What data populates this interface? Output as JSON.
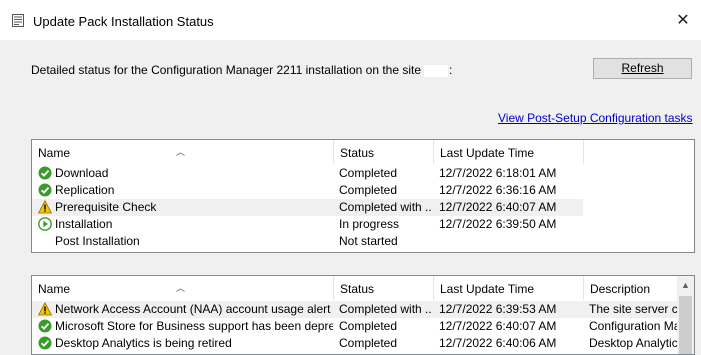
{
  "window": {
    "title": "Update Pack Installation Status",
    "close_glyph": "✕"
  },
  "description": {
    "text_before": "Detailed status for the Configuration Manager 2211 installation on the site",
    "text_after": ":"
  },
  "refresh_button": {
    "label": "Refresh"
  },
  "post_setup_link": "View Post-Setup Configuration tasks",
  "status_list": {
    "columns": [
      "Name",
      "Status",
      "Last Update Time"
    ],
    "rows": [
      {
        "icon": "check-icon",
        "name": "Download",
        "status": "Completed",
        "time": "12/7/2022 6:18:01 AM"
      },
      {
        "icon": "check-icon",
        "name": "Replication",
        "status": "Completed",
        "time": "12/7/2022 6:36:16 AM"
      },
      {
        "icon": "warning-icon",
        "name": "Prerequisite Check",
        "status": "Completed with ...",
        "time": "12/7/2022 6:40:07 AM"
      },
      {
        "icon": "play-icon",
        "name": "Installation",
        "status": "In progress",
        "time": "12/7/2022 6:39:50 AM"
      },
      {
        "icon": "",
        "name": "Post Installation",
        "status": "Not started",
        "time": ""
      }
    ]
  },
  "detail_list": {
    "columns": [
      "Name",
      "Status",
      "Last Update Time",
      "Description"
    ],
    "rows": [
      {
        "icon": "warning-icon",
        "name": "Network Access Account (NAA) account usage alert",
        "status": "Completed with ...",
        "time": "12/7/2022 6:39:53 AM",
        "description": "The site server configuration"
      },
      {
        "icon": "check-icon",
        "name": "Microsoft Store for Business support has been deprecated.",
        "status": "Completed",
        "time": "12/7/2022 6:40:07 AM",
        "description": "Configuration Manager"
      },
      {
        "icon": "check-icon",
        "name": "Desktop Analytics is being retired",
        "status": "Completed",
        "time": "12/7/2022 6:40:06 AM",
        "description": "Desktop Analytics"
      }
    ]
  }
}
